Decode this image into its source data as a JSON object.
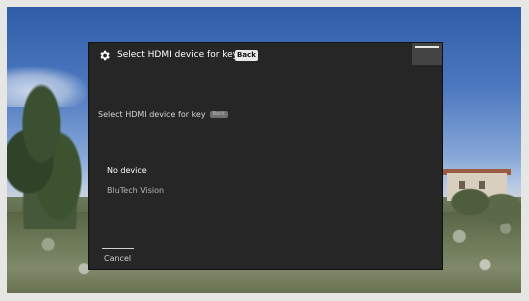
{
  "dialog": {
    "title": "Select HDMI device for key",
    "title_key_badge": "Back",
    "subtitle": "Select HDMI device for key",
    "subtitle_badge": "Back",
    "devices": [
      {
        "label": "No device",
        "selected": true
      },
      {
        "label": "BluTech Vision",
        "selected": false
      }
    ],
    "cancel_label": "Cancel"
  },
  "icons": {
    "title_icon": "gear-icon"
  },
  "colors": {
    "dialog_background": "#262626",
    "text_primary": "#ffffff",
    "text_secondary": "#b5b5b5",
    "badge_background": "#e8e8e8"
  }
}
